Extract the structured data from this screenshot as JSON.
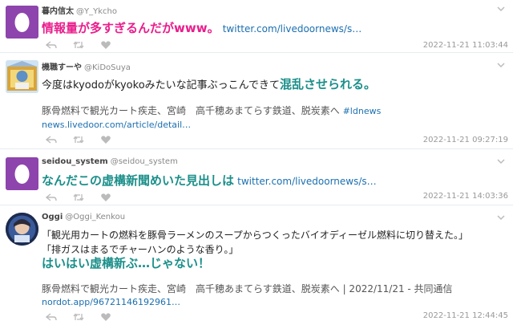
{
  "tweets": [
    {
      "user": "暮内信太",
      "handle": "@Y_Ykcho",
      "text": "情報量が多すぎるんだがwww。",
      "link": "twitter.com/livedoornews/s…",
      "time": "2022-11-21 11:03:44"
    },
    {
      "user": "機職すーや",
      "handle": "@KiDoSuya",
      "text_a": "今度はkyodoがkyokoみたいな記事ぶっこんできて",
      "text_b": "混乱させられる。",
      "news": "豚骨燃料で観光カート疾走、宮崎　高千穂あまてらす鉄道、脱炭素へ",
      "hashtag": "#ldnews",
      "link": "news.livedoor.com/article/detail…",
      "time": "2022-11-21 09:27:19"
    },
    {
      "user": "seidou_system",
      "handle": "@seidou_system",
      "text": "なんだこの虚構新聞めいた見出しは",
      "link": "twitter.com/livedoornews/s…",
      "time": "2022-11-21 14:03:36"
    },
    {
      "user": "Oggi",
      "handle": "@Oggi_Kenkou",
      "quote1": "「観光用カートの燃料を豚骨ラーメンのスープからつくったバイオディーゼル燃料に切り替えた。」",
      "quote2": "「排ガスはまるでチャーハンのような香り。」",
      "text": "はいはい虚構新ぶ…じゃない！",
      "news": "豚骨燃料で観光カート疾走、宮崎　高千穂あまてらす鉄道、脱炭素へ | 2022/11/21 - 共同通信",
      "link": "nordot.app/96721146192961…",
      "time": "2022-11-21 12:44:45"
    }
  ],
  "colors": {
    "egg": "#8e44ad",
    "magenta": "#e91e8c",
    "teal": "#1b8f8a",
    "link": "#1b6fb0"
  },
  "icons": [
    "egg-avatar-icon",
    "reply-icon",
    "retweet-icon",
    "like-icon",
    "chevron-down-icon"
  ]
}
